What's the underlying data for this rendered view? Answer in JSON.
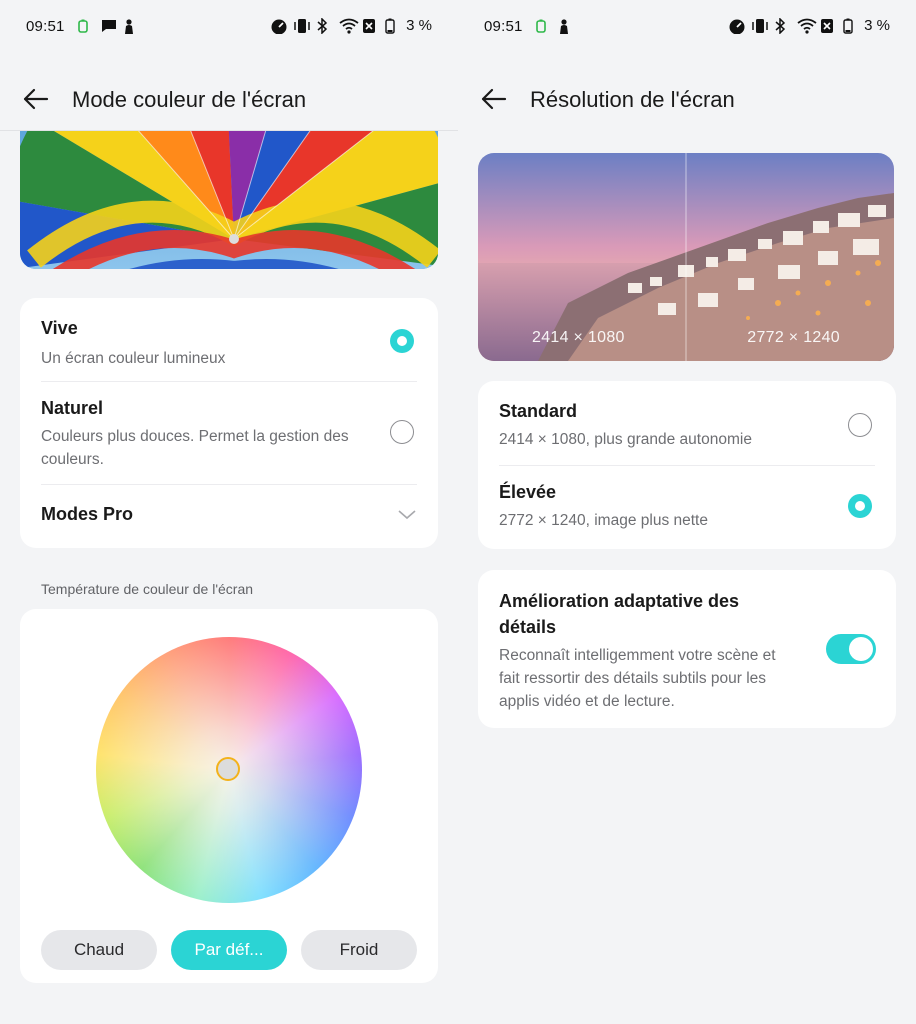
{
  "status": {
    "time": "09:51",
    "battery": "3 %"
  },
  "left": {
    "title": "Mode couleur de l'écran",
    "options": [
      {
        "title": "Vive",
        "subtitle": "Un écran couleur lumineux",
        "selected": true
      },
      {
        "title": "Naturel",
        "subtitle": "Couleurs plus douces. Permet la gestion des couleurs.",
        "selected": false
      }
    ],
    "pro_modes": "Modes Pro",
    "temp_label": "Température de couleur de l'écran",
    "temp_buttons": {
      "warm": "Chaud",
      "default": "Par déf...",
      "cold": "Froid"
    }
  },
  "right": {
    "title": "Résolution de l'écran",
    "preview_labels": {
      "left": "2414 × 1080",
      "right": "2772 × 1240"
    },
    "options": [
      {
        "title": "Standard",
        "subtitle": "2414 × 1080, plus grande autonomie",
        "selected": false
      },
      {
        "title": "Élevée",
        "subtitle": "2772 × 1240, image plus nette",
        "selected": true
      }
    ],
    "adaptive": {
      "title": "Amélioration adaptative des détails",
      "subtitle": "Reconnaît intelligemment votre scène et fait ressortir des détails subtils pour les applis vidéo et de lecture.",
      "enabled": true
    }
  },
  "colors": {
    "accent": "#2bd4d4",
    "knob_ring": "#f3b21a"
  }
}
